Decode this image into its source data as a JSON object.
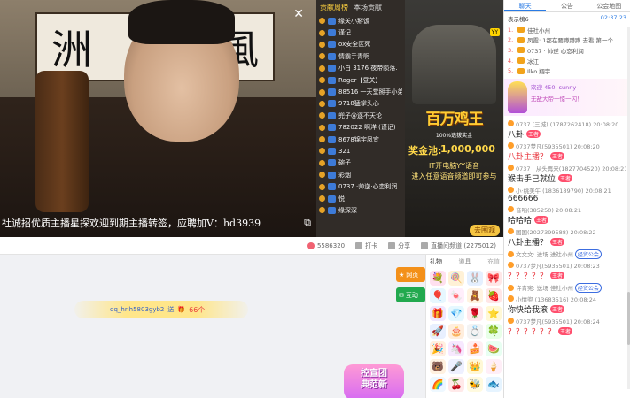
{
  "video": {
    "calligraphy": [
      "洲",
      "風"
    ],
    "ticker": "社诚招优质主播星探欢迎到期主播转签，应聘加V：hd3939",
    "close_icon": "close-icon"
  },
  "contrib": {
    "tabs": [
      "贡献周榜",
      "本场贡献"
    ],
    "items": [
      "缘关小掰饭",
      "谨记",
      "ox安全区死",
      "情霸手青啊",
      "小白 3176 夜帝陨落.",
      "Roger【昼关】",
      "88516 一天堂掰手小弟",
      "9718猛掌头心",
      "兜子@逐不天论",
      "782022 啊洋 (谨记)",
      "8678锦宇凤宜",
      "321",
      "碗子",
      "彩烟",
      "0737 ·帅逆·心恋利润",
      "悦",
      "缘深深"
    ]
  },
  "ad": {
    "yy_tag": "YY",
    "title": "百万鸡王",
    "subtitle": "100%选拔奖金",
    "pool_label": "奖金池:",
    "pool_value": "1,000,000",
    "line1": "IT开电脑YY语音",
    "line2": "进入任意语音频道即可参与",
    "cta": "去围观"
  },
  "infobar": {
    "fans": "5586320",
    "checkin": "打卡",
    "share": "分享",
    "report": "直播间频道 (2275012)"
  },
  "lower": {
    "msg_user": "qq_hrlh5803gyb2",
    "msg_text": "送",
    "msg_count": "66个",
    "promo_l1": "控宣团",
    "promo_l2": "典范新",
    "side_btn1": "网页",
    "side_btn2": "互动"
  },
  "gifts": {
    "tab1": "礼物",
    "tab2": "道具",
    "tab_right": "充值",
    "items": [
      "💐",
      "🍭",
      "🐰",
      "🎀",
      "🎈",
      "🍬",
      "🧸",
      "🍓",
      "🎁",
      "💎",
      "🌹",
      "⭐",
      "🚀",
      "🎂",
      "💍",
      "🍀",
      "🎉",
      "🦄",
      "🍰",
      "🍉",
      "🐻",
      "🎤",
      "👑",
      "🍦",
      "🌈",
      "🍒",
      "🐝",
      "🐟",
      "🍑"
    ]
  },
  "chat": {
    "tabs": [
      "聊天",
      "公告",
      "公会地图"
    ],
    "subhead_left": "表示榜6",
    "subhead_time": "02:37:23",
    "ranklist": [
      {
        "num": "1.",
        "text": "佳社小州"
      },
      {
        "num": "2.",
        "text": "凤霞: 1都在要蹲蹲蹲 去看 第一个"
      },
      {
        "num": "3.",
        "text": "0737 · 帅逆 心恋利润"
      },
      {
        "num": "4.",
        "text": "冰江"
      },
      {
        "num": "5.",
        "text": "Ilko 翔宇"
      }
    ],
    "banner_l1": "欢迎 450, sunny",
    "banner_l2": "无敌大帝一惊一闪！",
    "messages": [
      {
        "meta": "0737 (三城) (1787262418) 20:08:20",
        "body": "八卦",
        "tag": "王者",
        "style": ""
      },
      {
        "meta": "0737梦凡(5935501) 20:08:20",
        "body": "八卦主播？",
        "tag": "王者",
        "style": "red"
      },
      {
        "meta": "0737 · 从头再来(1827704520) 20:08:21",
        "body": "猴击手已就位",
        "tag": "王者",
        "style": ""
      },
      {
        "meta": "小·桃美午 (1836189790) 20:08:21",
        "body": "666666",
        "tag": "",
        "style": ""
      },
      {
        "meta": "音响(385250) 20:08:21",
        "body": "哈哈哈",
        "tag": "王者",
        "style": ""
      },
      {
        "meta": "国国(2027399588) 20:08:22",
        "body": "八卦主播？",
        "tag": "王者",
        "style": ""
      },
      {
        "meta": "文文文: 进场 进社小州",
        "body": "",
        "tag": "经贸公会",
        "style": "purple"
      },
      {
        "meta": "0737梦凡(5935501) 20:08:23",
        "body": "？？？？？",
        "tag": "王者",
        "style": "red"
      },
      {
        "meta": "许青宪: 送场 佳社小州",
        "body": "",
        "tag": "经贸公会",
        "style": "purple"
      },
      {
        "meta": "小情兜 (13683516) 20:08:24",
        "body": "你快给我滚",
        "tag": "王者",
        "style": ""
      },
      {
        "meta": "0737梦凡(5935501) 20:08:24",
        "body": "？？？？？？",
        "tag": "王者",
        "style": "red"
      }
    ]
  }
}
